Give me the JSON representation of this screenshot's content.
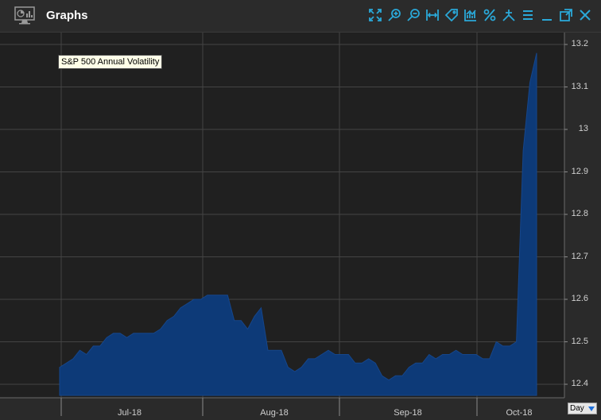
{
  "window": {
    "title": "Graphs"
  },
  "toolbar": [
    {
      "name": "fullscreen-icon"
    },
    {
      "name": "zoom-in-icon"
    },
    {
      "name": "zoom-out-icon"
    },
    {
      "name": "fit-width-icon"
    },
    {
      "name": "tag-icon"
    },
    {
      "name": "chart-type-icon"
    },
    {
      "name": "percent-icon"
    },
    {
      "name": "indicator-icon"
    },
    {
      "name": "menu-icon"
    },
    {
      "name": "minimize-icon"
    },
    {
      "name": "popout-icon"
    },
    {
      "name": "close-icon"
    }
  ],
  "colors": {
    "accent": "#2aa8d8",
    "series_fill": "#0d3a78",
    "plot_bg": "#202020",
    "grid": "#444444"
  },
  "period_selector": {
    "value": "Day"
  },
  "chart_data": {
    "type": "area",
    "title": "S&P 500 Annual Volatility",
    "x_tick_labels": [
      "Jul-18",
      "Aug-18",
      "Sep-18",
      "Oct-18"
    ],
    "y_ticks": [
      12.4,
      12.5,
      12.6,
      12.7,
      12.8,
      12.9,
      13,
      13.1,
      13.2
    ],
    "ylim": [
      12.37,
      13.22
    ],
    "grid": true,
    "series": [
      {
        "values": [
          12.44,
          12.45,
          12.46,
          12.48,
          12.47,
          12.49,
          12.49,
          12.51,
          12.52,
          12.52,
          12.51,
          12.52,
          12.52,
          12.52,
          12.52,
          12.53,
          12.55,
          12.56,
          12.58,
          12.59,
          12.6,
          12.6,
          12.61,
          12.61,
          12.61,
          12.61,
          12.55,
          12.55,
          12.53,
          12.56,
          12.58,
          12.48,
          12.48,
          12.48,
          12.44,
          12.43,
          12.44,
          12.46,
          12.46,
          12.47,
          12.48,
          12.47,
          12.47,
          12.47,
          12.45,
          12.45,
          12.46,
          12.45,
          12.42,
          12.41,
          12.42,
          12.42,
          12.44,
          12.45,
          12.45,
          12.47,
          12.46,
          12.47,
          12.47,
          12.48,
          12.47,
          12.47,
          12.47,
          12.46,
          12.46,
          12.5,
          12.49,
          12.49,
          12.5,
          12.95,
          13.11,
          13.18
        ]
      }
    ]
  }
}
